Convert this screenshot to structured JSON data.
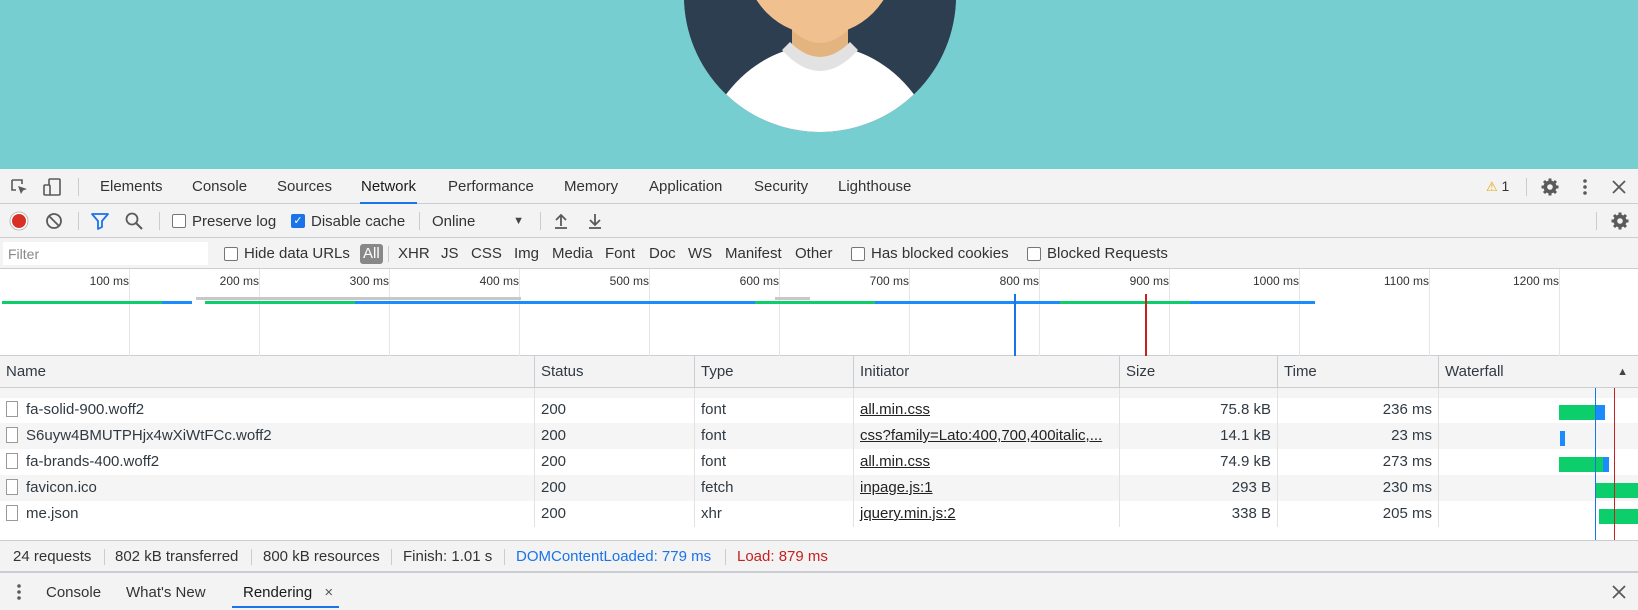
{
  "colors": {
    "page_bg": "#76ced0",
    "accent": "#1a73e8",
    "record_red": "#d93025",
    "dom_content_loaded": "#1a73e8",
    "load": "#c5221f",
    "waterfall_green": "#0cce6b",
    "waterfall_blue": "#1a8cff"
  },
  "icons": {
    "inspect": "inspect-element-icon",
    "device": "device-toolbar-icon",
    "warning": "warning-icon",
    "settings": "gear-icon",
    "more": "kebab-menu-icon",
    "close": "close-icon",
    "record": "record-icon",
    "clear": "clear-icon",
    "filter": "filter-icon",
    "search": "search-icon",
    "import": "import-har-icon",
    "export": "export-har-icon"
  },
  "tabs": [
    "Elements",
    "Console",
    "Sources",
    "Network",
    "Performance",
    "Memory",
    "Application",
    "Security",
    "Lighthouse"
  ],
  "active_tab": "Network",
  "warning_count": "1",
  "toolbar": {
    "preserve_log": "Preserve log",
    "preserve_log_checked": false,
    "disable_cache": "Disable cache",
    "disable_cache_checked": true,
    "throttling": "Online"
  },
  "filter": {
    "placeholder": "Filter",
    "hide_data_urls": "Hide data URLs",
    "types": [
      "All",
      "XHR",
      "JS",
      "CSS",
      "Img",
      "Media",
      "Font",
      "Doc",
      "WS",
      "Manifest",
      "Other"
    ],
    "active_type": "All",
    "has_blocked_cookies": "Has blocked cookies",
    "blocked_requests": "Blocked Requests"
  },
  "overview_ticks": [
    "100 ms",
    "200 ms",
    "300 ms",
    "400 ms",
    "500 ms",
    "600 ms",
    "700 ms",
    "800 ms",
    "900 ms",
    "1000 ms",
    "1100 ms",
    "1200 ms"
  ],
  "columns": [
    "Name",
    "Status",
    "Type",
    "Initiator",
    "Size",
    "Time",
    "Waterfall"
  ],
  "sort_indicator": "▲",
  "rows": [
    {
      "name": "fa-solid-900.woff2",
      "status": "200",
      "type": "font",
      "initiator": "all.min.css",
      "size": "75.8 kB",
      "time": "236 ms"
    },
    {
      "name": "S6uyw4BMUTPHjx4wXiWtFCc.woff2",
      "status": "200",
      "type": "font",
      "initiator": "css?family=Lato:400,700,400italic,...",
      "size": "14.1 kB",
      "time": "23 ms"
    },
    {
      "name": "fa-brands-400.woff2",
      "status": "200",
      "type": "font",
      "initiator": "all.min.css",
      "size": "74.9 kB",
      "time": "273 ms"
    },
    {
      "name": "favicon.ico",
      "status": "200",
      "type": "fetch",
      "initiator": "inpage.js:1",
      "size": "293 B",
      "time": "230 ms"
    },
    {
      "name": "me.json",
      "status": "200",
      "type": "xhr",
      "initiator": "jquery.min.js:2",
      "size": "338 B",
      "time": "205 ms"
    }
  ],
  "summary": {
    "requests": "24 requests",
    "transferred": "802 kB transferred",
    "resources": "800 kB resources",
    "finish": "Finish: 1.01 s",
    "dom_content_loaded": "DOMContentLoaded: 779 ms",
    "load": "Load: 879 ms"
  },
  "drawer": {
    "tabs": [
      "Console",
      "What's New",
      "Rendering"
    ],
    "active": "Rendering",
    "close_glyph": "×"
  }
}
